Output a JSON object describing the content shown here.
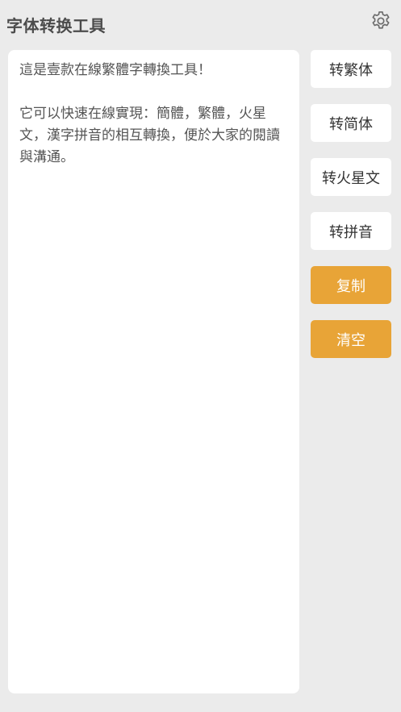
{
  "header": {
    "title": "字体转换工具",
    "settings_icon": "gear-icon"
  },
  "editor": {
    "text": "這是壹款在線繁體字轉換工具！\n\n它可以快速在線實現：簡體，繁體，火星文，漢字拼音的相互轉換，便於大家的閱讀與溝通。"
  },
  "actions": {
    "to_traditional": "转繁体",
    "to_simplified": "转简体",
    "to_martian": "转火星文",
    "to_pinyin": "转拼音",
    "copy": "复制",
    "clear": "清空"
  },
  "colors": {
    "accent": "#e8a437",
    "background": "#ebebeb",
    "surface": "#ffffff"
  }
}
